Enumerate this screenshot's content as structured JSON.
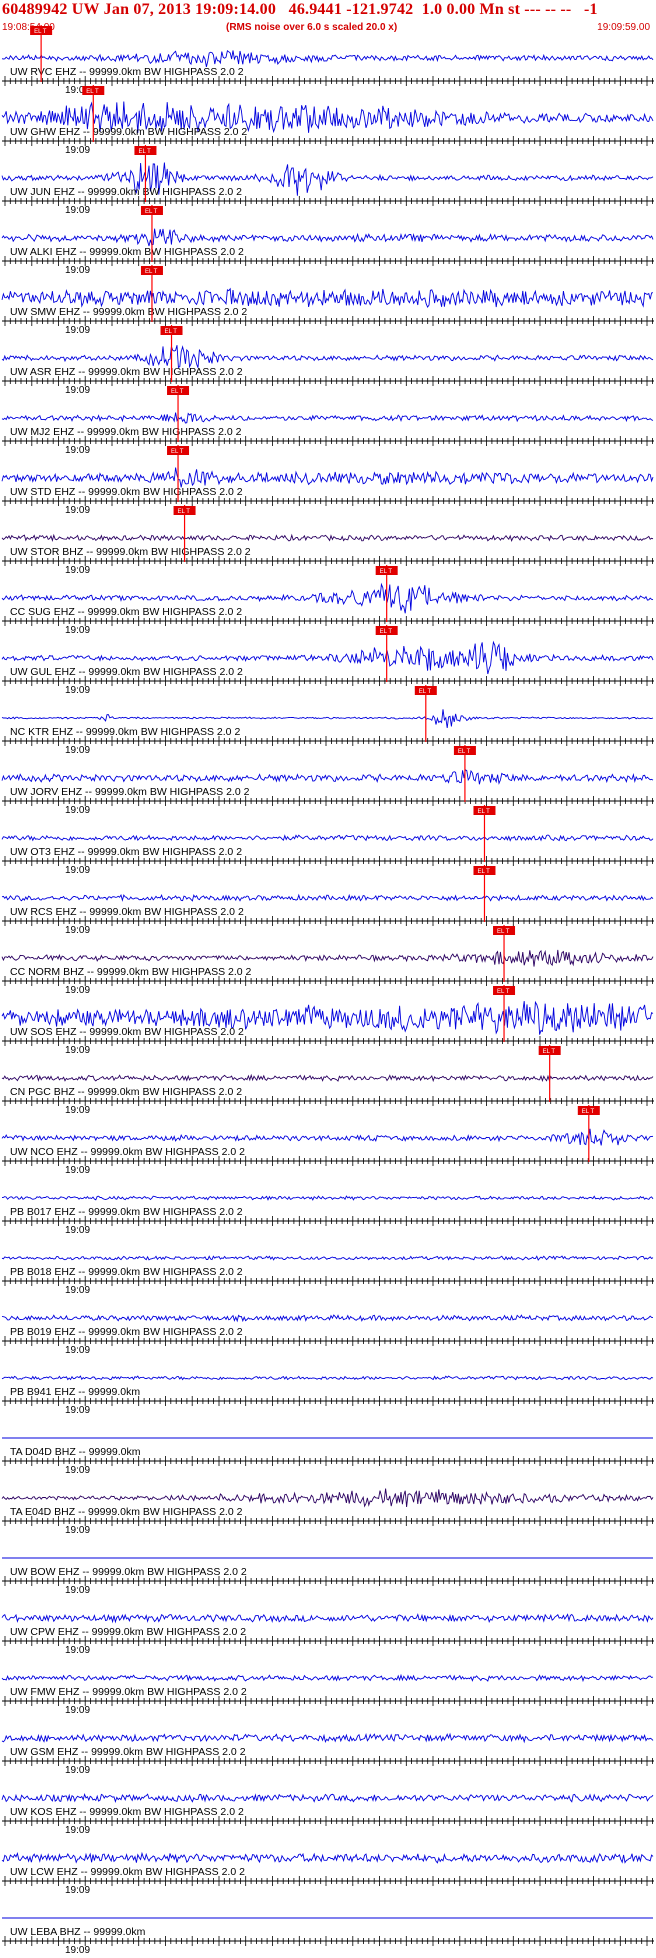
{
  "header": {
    "title": "60489942 UW Jan 07, 2013 19:09:14.00   46.9441 -121.9742  1.0 0.00 Mn st --- -- --   -1",
    "start_time": "19:08:54.00",
    "note": "(RMS noise over 6.0 s scaled 20.0 x)",
    "end_time": "19:09:59.00"
  },
  "colors": {
    "title": "#d40000",
    "trace": "#0000dd",
    "trace_dark": "#2a0060",
    "pick_line": "#ff0000",
    "pick_box": "#e00000",
    "axis": "#000000"
  },
  "pick_label": "EL T",
  "traces": [
    {
      "label": "UW RVC EHZ -- 99999.0km BW  HIGHPASS  2.0  2",
      "time": "19:09",
      "amp": 3,
      "dark": false,
      "pick": 0.06,
      "events": [
        [
          0.33,
          7,
          60
        ]
      ]
    },
    {
      "label": "UW GHW EHZ -- 99999.0km BW  HIGHPASS  2.0  2",
      "time": "19:09",
      "amp": 5,
      "dark": false,
      "pick": 0.14,
      "events": [
        [
          0.2,
          14,
          70
        ],
        [
          0.5,
          12,
          90
        ]
      ]
    },
    {
      "label": "UW JUN EHZ -- 99999.0km BW  HIGHPASS  2.0  2",
      "time": "19:09",
      "amp": 3,
      "dark": false,
      "pick": 0.22,
      "events": [
        [
          0.225,
          20,
          20
        ],
        [
          0.46,
          18,
          20
        ]
      ]
    },
    {
      "label": "UW ALKI EHZ -- 99999.0km BW  HIGHPASS  2.0  2",
      "time": "19:09",
      "amp": 4,
      "dark": false,
      "pick": 0.23,
      "events": [
        [
          0.235,
          12,
          14
        ]
      ]
    },
    {
      "label": "UW SMW EHZ -- 99999.0km BW  HIGHPASS  2.0  2",
      "time": "19:09",
      "amp": 7,
      "dark": false,
      "pick": 0.23,
      "events": [
        [
          0.5,
          4,
          200
        ]
      ]
    },
    {
      "label": "UW ASR EHZ -- 99999.0km BW  HIGHPASS  2.0  2",
      "time": "19:09",
      "amp": 3,
      "dark": false,
      "pick": 0.26,
      "events": [
        [
          0.275,
          16,
          20
        ]
      ]
    },
    {
      "label": "UW MJ2 EHZ -- 99999.0km BW  HIGHPASS  2.0  2",
      "time": "19:09",
      "amp": 3,
      "dark": false,
      "pick": 0.27,
      "events": [
        [
          0.28,
          6,
          14
        ]
      ]
    },
    {
      "label": "UW STD EHZ -- 99999.0km BW  HIGHPASS  2.0  2",
      "time": "19:09",
      "amp": 4,
      "dark": false,
      "pick": 0.27,
      "events": [
        [
          0.28,
          8,
          20
        ],
        [
          0.6,
          4,
          160
        ]
      ]
    },
    {
      "label": "UW STOR BHZ -- 99999.0km BW  HIGHPASS  2.0  2",
      "time": "19:09",
      "amp": 3,
      "dark": true,
      "pick": 0.28,
      "events": []
    },
    {
      "label": "CC SUG EHZ -- 99999.0km BW  HIGHPASS  2.0  2",
      "time": "19:09",
      "amp": 3,
      "dark": false,
      "pick": 0.59,
      "events": [
        [
          0.6,
          16,
          40
        ]
      ]
    },
    {
      "label": "UW GUL EHZ -- 99999.0km BW  HIGHPASS  2.0  2",
      "time": "19:09",
      "amp": 3,
      "dark": false,
      "pick": 0.59,
      "events": [
        [
          0.64,
          14,
          50
        ],
        [
          0.75,
          18,
          15
        ]
      ]
    },
    {
      "label": "NC KTR EHZ -- 99999.0km BW  HIGHPASS  2.0  2",
      "time": "19:09",
      "amp": 1,
      "dark": false,
      "pick": 0.65,
      "events": [
        [
          0.68,
          10,
          12
        ],
        [
          0.16,
          5,
          4
        ]
      ]
    },
    {
      "label": "UW JORV EHZ -- 99999.0km BW  HIGHPASS  2.0  2",
      "time": "19:09",
      "amp": 4,
      "dark": false,
      "pick": 0.71,
      "events": [
        [
          0.72,
          6,
          20
        ]
      ]
    },
    {
      "label": "UW OT3 EHZ -- 99999.0km BW  HIGHPASS  2.0  2",
      "time": "19:09",
      "amp": 3,
      "dark": false,
      "pick": 0.74,
      "events": []
    },
    {
      "label": "UW RCS EHZ -- 99999.0km BW  HIGHPASS  2.0  2",
      "time": "19:09",
      "amp": 3,
      "dark": false,
      "pick": 0.74,
      "events": []
    },
    {
      "label": "CC NORM BHZ -- 99999.0km BW  HIGHPASS  2.0  2",
      "time": "19:09",
      "amp": 3,
      "dark": true,
      "pick": 0.77,
      "events": [
        [
          0.82,
          8,
          50
        ]
      ]
    },
    {
      "label": "UW SOS EHZ -- 99999.0km BW  HIGHPASS  2.0  2",
      "time": "19:09",
      "amp": 6,
      "dark": false,
      "pick": 0.77,
      "events": [
        [
          0.5,
          8,
          220
        ],
        [
          0.86,
          12,
          80
        ]
      ]
    },
    {
      "label": "CN PGC BHZ -- 99999.0km BW  HIGHPASS  2.0  2",
      "time": "19:09",
      "amp": 3,
      "dark": true,
      "pick": 0.84,
      "events": []
    },
    {
      "label": "UW NCO EHZ -- 99999.0km BW  HIGHPASS  2.0  2",
      "time": "19:09",
      "amp": 3,
      "dark": false,
      "pick": 0.9,
      "events": [
        [
          0.91,
          10,
          20
        ]
      ]
    },
    {
      "label": "PB B017 EHZ -- 99999.0km BW  HIGHPASS  2.0  2",
      "time": "19:09",
      "amp": 2,
      "dark": false,
      "pick": null,
      "events": []
    },
    {
      "label": "PB B018 EHZ -- 99999.0km BW  HIGHPASS  2.0  2",
      "time": "19:09",
      "amp": 2,
      "dark": false,
      "pick": null,
      "events": []
    },
    {
      "label": "PB B019 EHZ -- 99999.0km BW  HIGHPASS  2.0  2",
      "time": "19:09",
      "amp": 3,
      "dark": false,
      "pick": null,
      "events": []
    },
    {
      "label": "PB B941 EHZ -- 99999.0km",
      "time": "19:09",
      "amp": 2,
      "dark": false,
      "pick": null,
      "events": []
    },
    {
      "label": "TA D04D BHZ -- 99999.0km",
      "time": "19:09",
      "amp": 0,
      "dark": false,
      "pick": null,
      "events": []
    },
    {
      "label": "TA E04D BHZ -- 99999.0km BW  HIGHPASS  2.0  2",
      "time": "19:09",
      "amp": 2,
      "dark": true,
      "pick": null,
      "events": [
        [
          0.62,
          8,
          120
        ]
      ]
    },
    {
      "label": "UW BOW EHZ -- 99999.0km BW  HIGHPASS  2.0  2",
      "time": "19:09",
      "amp": 0,
      "dark": false,
      "pick": null,
      "events": []
    },
    {
      "label": "UW CPW EHZ -- 99999.0km BW  HIGHPASS  2.0  2",
      "time": "19:09",
      "amp": 4,
      "dark": false,
      "pick": null,
      "events": []
    },
    {
      "label": "UW FMW EHZ -- 99999.0km BW  HIGHPASS  2.0  2",
      "time": "19:09",
      "amp": 3,
      "dark": false,
      "pick": null,
      "events": []
    },
    {
      "label": "UW GSM EHZ -- 99999.0km BW  HIGHPASS  2.0  2",
      "time": "19:09",
      "amp": 4,
      "dark": false,
      "pick": null,
      "events": []
    },
    {
      "label": "UW KOS EHZ -- 99999.0km BW  HIGHPASS  2.0  2",
      "time": "19:09",
      "amp": 4,
      "dark": false,
      "pick": null,
      "events": []
    },
    {
      "label": "UW LCW EHZ -- 99999.0km BW  HIGHPASS  2.0  2",
      "time": "19:09",
      "amp": 5,
      "dark": false,
      "pick": null,
      "events": []
    },
    {
      "label": "UW LEBA BHZ -- 99999.0km",
      "time": "19:09",
      "amp": 0,
      "dark": false,
      "pick": null,
      "events": []
    }
  ]
}
